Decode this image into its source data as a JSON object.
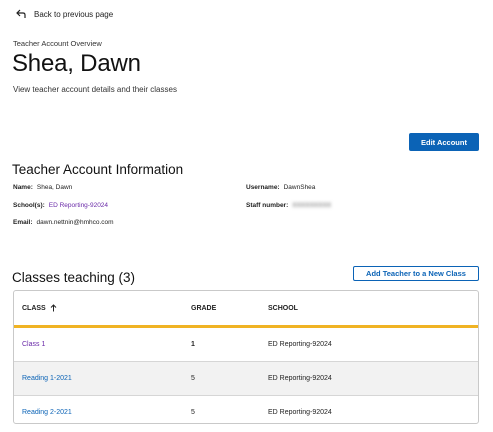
{
  "nav": {
    "back_label": "Back to previous page"
  },
  "header": {
    "overline": "Teacher Account Overview",
    "name": "Shea, Dawn",
    "subtitle": "View teacher account details and their classes",
    "edit_button": "Edit Account"
  },
  "info": {
    "title": "Teacher Account Information",
    "name_label": "Name:",
    "name_value": "Shea, Dawn",
    "schools_label": "School(s):",
    "schools_value": "ED Reporting-92024",
    "email_label": "Email:",
    "email_value": "dawn.nettnin@hmhco.com",
    "username_label": "Username:",
    "username_value": "DawnShea",
    "staff_label": "Staff number:",
    "staff_value": "XXXXXXXXX"
  },
  "classes": {
    "title": "Classes teaching (3)",
    "add_button": "Add Teacher to a New Class",
    "columns": {
      "class": "CLASS",
      "sort_icon": "arrow-up-icon",
      "grade": "GRADE",
      "school": "SCHOOL"
    },
    "rows": [
      {
        "class": "Class 1",
        "grade": "1",
        "school": "ED Reporting-92024"
      },
      {
        "class": "Reading 1-2021",
        "grade": "5",
        "school": "ED Reporting-92024"
      },
      {
        "class": "Reading 2-2021",
        "grade": "5",
        "school": "ED Reporting-92024"
      }
    ]
  },
  "colors": {
    "primary": "#0b63b6",
    "accent_underline": "#f0b323",
    "link_purple": "#6a2aa8"
  }
}
